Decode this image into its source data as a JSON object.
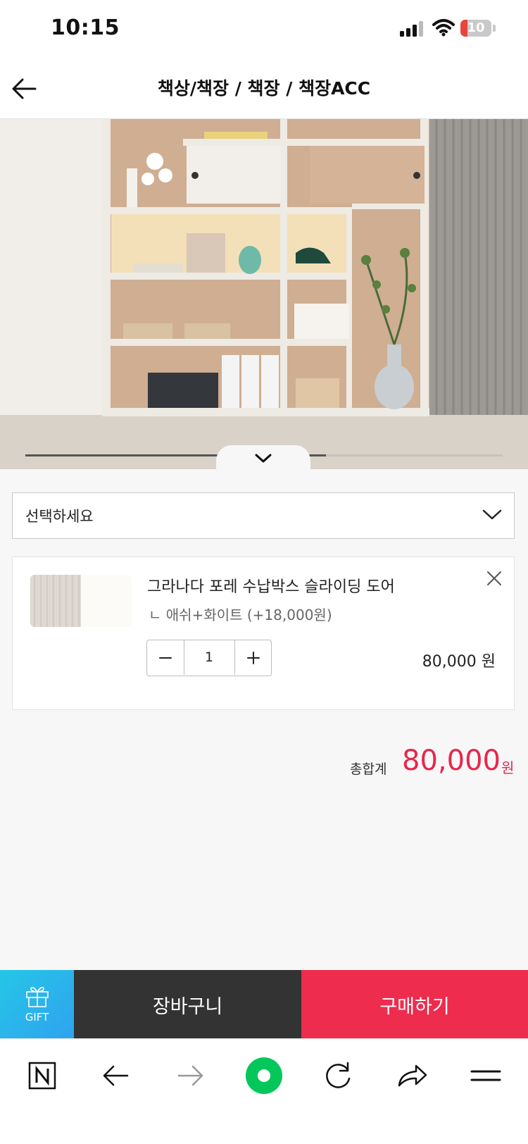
{
  "status_bar": {
    "time": "10:15",
    "battery": "10"
  },
  "header": {
    "title": "책상/책장 / 책장 / 책장ACC"
  },
  "gallery": {
    "progress_fraction": 0.63
  },
  "option_select": {
    "placeholder": "선택하세요"
  },
  "selected_item": {
    "name": "그라나다 포레 수납박스 슬라이딩 도어",
    "option": "ㄴ 애쉬+화이트 (+18,000원)",
    "quantity": "1",
    "price": "80,000 원"
  },
  "total": {
    "label": "총합계",
    "amount": "80,000",
    "unit": "원"
  },
  "actions": {
    "gift_label": "GIFT",
    "cart_label": "장바구니",
    "buy_label": "구매하기"
  },
  "colors": {
    "accent": "#ee2c4e",
    "price_red": "#e8264c",
    "cart_bg": "#333333",
    "gift_bg": "#2fa3f0",
    "naver_green": "#03c75a"
  },
  "browser_toolbar": {
    "icons": [
      "naver-n-icon",
      "back-arrow-icon",
      "forward-arrow-icon",
      "green-home-icon",
      "reload-icon",
      "share-icon",
      "menu-icon"
    ]
  }
}
